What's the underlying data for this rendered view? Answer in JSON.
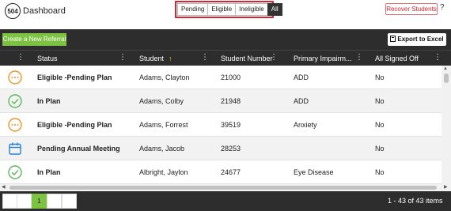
{
  "app": {
    "logo_text": "504",
    "title": "Dashboard"
  },
  "filters": {
    "options": [
      "Pending",
      "Eligible",
      "Ineligible",
      "All"
    ],
    "active": "All"
  },
  "recover_label": "Recover Students",
  "help_label": "?",
  "toolbar": {
    "create_label": "Create a New Referral",
    "export_label": "Export to Excel"
  },
  "columns": [
    {
      "label": "Status"
    },
    {
      "label": "Student",
      "sort": "ascending",
      "sort_glyph": "↑"
    },
    {
      "label": "Student Number"
    },
    {
      "label": "Primary Impairm..."
    },
    {
      "label": "All Signed Off"
    }
  ],
  "column_menu_glyph": "⋮",
  "rows": [
    {
      "icon": "pending-icon",
      "status": "Eligible -Pending Plan",
      "student": "Adams, Clayton",
      "number": "21000",
      "impairment": "ADD",
      "signed_off": "No"
    },
    {
      "icon": "check-circle-icon",
      "status": "In Plan",
      "student": "Adams, Colby",
      "number": "21948",
      "impairment": "ADD",
      "signed_off": "No"
    },
    {
      "icon": "pending-icon",
      "status": "Eligible -Pending Plan",
      "student": "Adams, Forrest",
      "number": "39519",
      "impairment": "Anxiety",
      "signed_off": "No"
    },
    {
      "icon": "calendar-icon",
      "status": "Pending Annual Meeting",
      "student": "Adams, Jacob",
      "number": "28253",
      "impairment": "",
      "signed_off": "No"
    },
    {
      "icon": "check-circle-icon",
      "status": "In Plan",
      "student": "Albright, Jaylon",
      "number": "24677",
      "impairment": "Eye Disease",
      "signed_off": "No"
    }
  ],
  "pager": {
    "current_page": "1",
    "info": "1 - 43 of 43 items"
  },
  "colors": {
    "accent_green": "#7dc242",
    "header_dark": "#2d2d2d",
    "alert_red": "#d9232e",
    "pending_orange": "#f0932b",
    "check_green": "#5cb85c",
    "calendar_blue": "#2a7fd4",
    "sort_yellow": "#f2c500"
  }
}
